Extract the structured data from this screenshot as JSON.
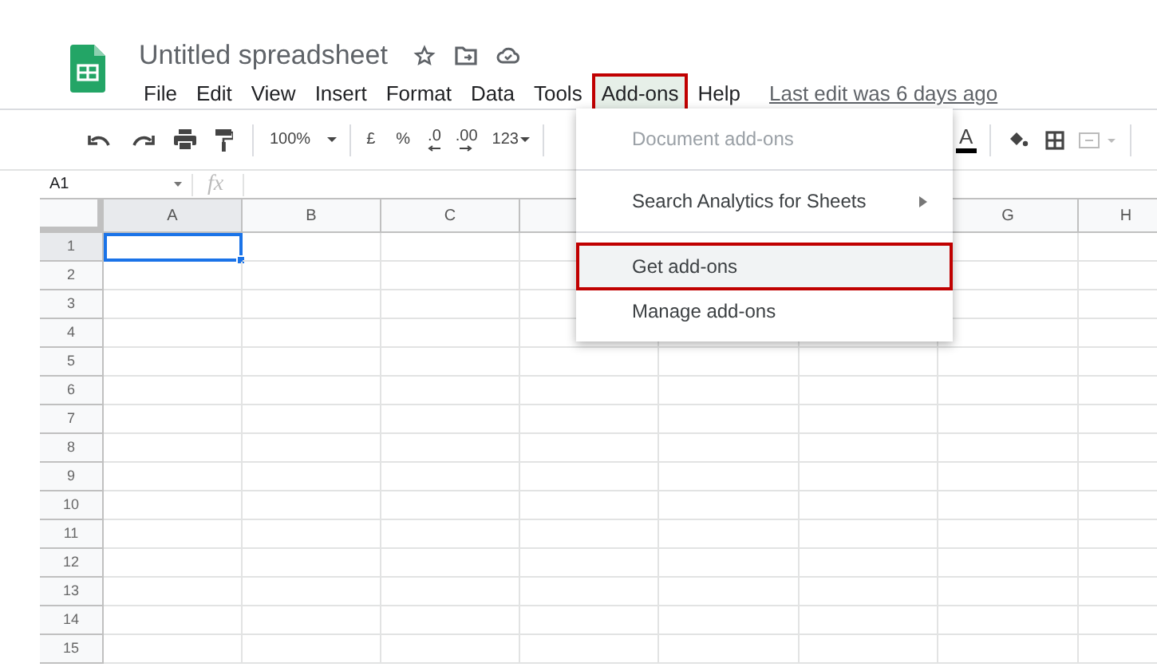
{
  "document": {
    "title": "Untitled spreadsheet"
  },
  "menu_bar": [
    {
      "label": "File",
      "selected": false
    },
    {
      "label": "Edit",
      "selected": false
    },
    {
      "label": "View",
      "selected": false
    },
    {
      "label": "Insert",
      "selected": false
    },
    {
      "label": "Format",
      "selected": false
    },
    {
      "label": "Data",
      "selected": false
    },
    {
      "label": "Tools",
      "selected": false
    },
    {
      "label": "Add-ons",
      "selected": true
    },
    {
      "label": "Help",
      "selected": false
    }
  ],
  "last_edit": "Last edit was 6 days ago",
  "toolbar": {
    "zoom": "100%",
    "currency": "£",
    "percent": "%",
    "decrease_decimals": ".0",
    "increase_decimals": ".00",
    "number_format": "123",
    "text_color": "A"
  },
  "formula_bar": {
    "name_box": "A1",
    "fx": "fx"
  },
  "column_headers_left": [
    {
      "label": "A",
      "selected": true
    },
    {
      "label": "B",
      "selected": false
    },
    {
      "label": "C",
      "selected": false
    }
  ],
  "column_headers_right": [
    {
      "label": "G",
      "selected": false
    },
    {
      "label": "H",
      "selected": false
    }
  ],
  "rows": [
    {
      "label": "1",
      "selected": true
    },
    {
      "label": "2",
      "selected": false
    },
    {
      "label": "3",
      "selected": false
    },
    {
      "label": "4",
      "selected": false
    },
    {
      "label": "5",
      "selected": false
    },
    {
      "label": "6",
      "selected": false
    },
    {
      "label": "7",
      "selected": false
    },
    {
      "label": "8",
      "selected": false
    },
    {
      "label": "9",
      "selected": false
    },
    {
      "label": "10",
      "selected": false
    },
    {
      "label": "11",
      "selected": false
    },
    {
      "label": "12",
      "selected": false
    },
    {
      "label": "13",
      "selected": false
    },
    {
      "label": "14",
      "selected": false
    },
    {
      "label": "15",
      "selected": false
    }
  ],
  "dropdown_menu": [
    {
      "kind": "item",
      "label": "Document add-ons",
      "disabled": true,
      "submenu": false,
      "highlighted": false
    },
    {
      "kind": "separator"
    },
    {
      "kind": "item",
      "label": "Search Analytics for Sheets",
      "disabled": false,
      "submenu": true,
      "highlighted": false
    },
    {
      "kind": "separator"
    },
    {
      "kind": "item",
      "label": "Get add-ons",
      "disabled": false,
      "submenu": false,
      "highlighted": true
    },
    {
      "kind": "item",
      "label": "Manage add-ons",
      "disabled": false,
      "submenu": false,
      "highlighted": false
    }
  ]
}
